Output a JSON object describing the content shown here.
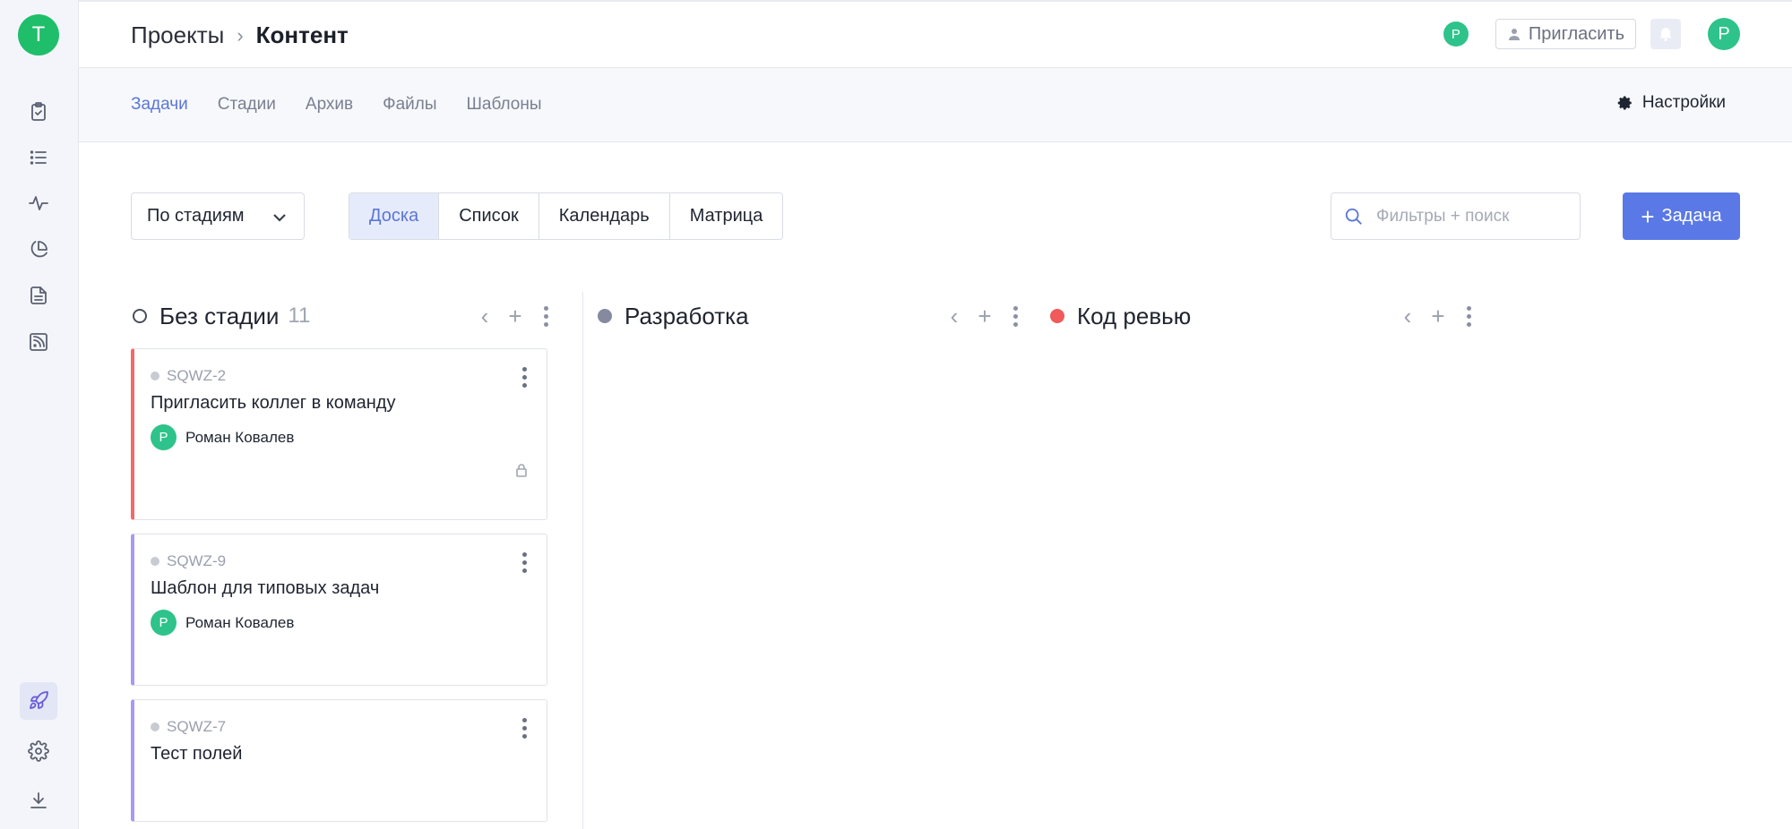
{
  "workspace": {
    "initial": "T",
    "color": "#1fbe6a"
  },
  "rail": {
    "icons": [
      "clipboard-check-icon",
      "list-icon",
      "activity-icon",
      "pie-chart-icon",
      "document-icon",
      "rss-icon"
    ],
    "bottom": [
      "rocket-icon",
      "gear-icon",
      "download-icon"
    ]
  },
  "breadcrumb": {
    "parent": "Проекты",
    "current": "Контент"
  },
  "header": {
    "member_initial": "Р",
    "invite_label": "Пригласить",
    "user_initial": "Р"
  },
  "subnav": {
    "tabs": [
      {
        "label": "Задачи",
        "active": true
      },
      {
        "label": "Стадии",
        "active": false
      },
      {
        "label": "Архив",
        "active": false
      },
      {
        "label": "Файлы",
        "active": false
      },
      {
        "label": "Шаблоны",
        "active": false
      }
    ],
    "settings_label": "Настройки"
  },
  "toolbar": {
    "group_by": "По стадиям",
    "views": [
      {
        "label": "Доска",
        "active": true
      },
      {
        "label": "Список",
        "active": false
      },
      {
        "label": "Календарь",
        "active": false
      },
      {
        "label": "Матрица",
        "active": false
      }
    ],
    "search_placeholder": "Фильтры + поиск",
    "add_task_label": "Задача"
  },
  "columns": [
    {
      "title": "Без стадии",
      "count": "11",
      "dot": "empty"
    },
    {
      "title": "Разработка",
      "count": "",
      "dot": "#858a9e"
    },
    {
      "title": "Код ревью",
      "count": "",
      "dot": "#f05a5a"
    }
  ],
  "cards": [
    {
      "id": "SQWZ-2",
      "title": "Пригласить коллег в команду",
      "assignee_initial": "Р",
      "assignee": "Роман Ковалев",
      "accent": "#f06b6b",
      "locked": true
    },
    {
      "id": "SQWZ-9",
      "title": "Шаблон для типовых задач",
      "assignee_initial": "Р",
      "assignee": "Роман Ковалев",
      "accent": "#a89af0",
      "locked": false
    },
    {
      "id": "SQWZ-7",
      "title": "Тест полей",
      "assignee_initial": "",
      "assignee": "",
      "accent": "#a89af0",
      "locked": false
    }
  ]
}
